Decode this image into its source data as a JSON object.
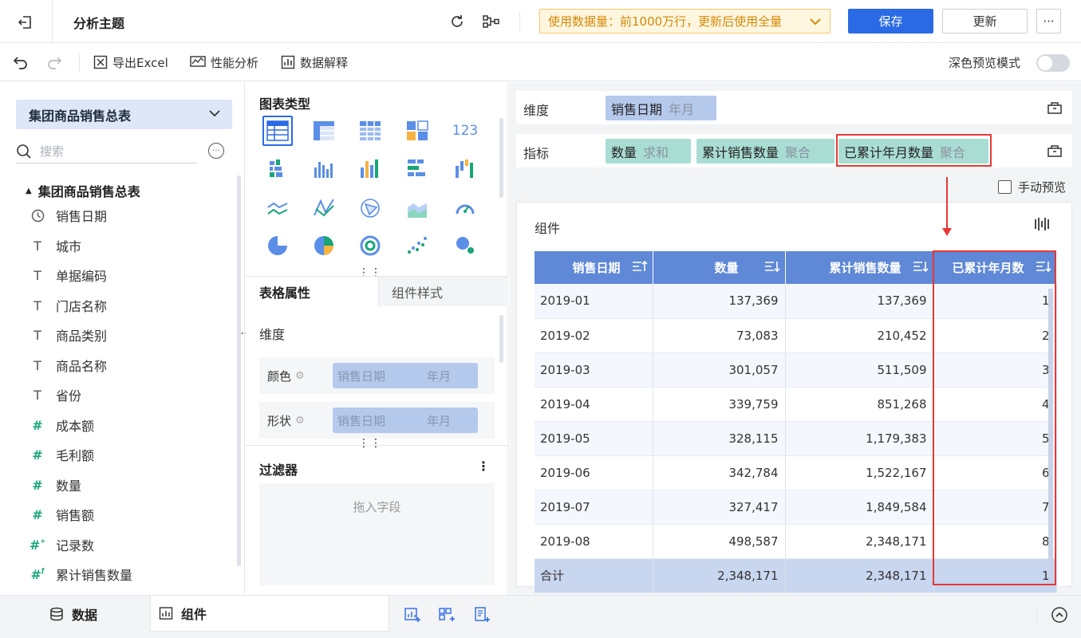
{
  "header": {
    "title": "分析主题",
    "data_usage": "使用数据量：前1000万行，更新后使用全量",
    "save_label": "保存",
    "update_label": "更新",
    "more_label": "···"
  },
  "toolbar": {
    "export_excel": "导出Excel",
    "performance": "性能分析",
    "data_explain": "数据解释",
    "dark_preview": "深色预览模式"
  },
  "left": {
    "dataset": "集团商品销售总表",
    "search_placeholder": "搜索",
    "tree_root": "集团商品销售总表",
    "fields": [
      {
        "icon": "clock-icon",
        "name": "销售日期"
      },
      {
        "icon": "text-icon",
        "name": "城市"
      },
      {
        "icon": "text-icon",
        "name": "单据编码"
      },
      {
        "icon": "text-icon",
        "name": "门店名称"
      },
      {
        "icon": "text-icon",
        "name": "商品类别"
      },
      {
        "icon": "text-icon",
        "name": "商品名称"
      },
      {
        "icon": "text-icon",
        "name": "省份"
      },
      {
        "icon": "number-icon",
        "name": "成本额"
      },
      {
        "icon": "number-icon",
        "name": "毛利额"
      },
      {
        "icon": "number-icon",
        "name": "数量"
      },
      {
        "icon": "number-icon",
        "name": "销售额"
      },
      {
        "icon": "record-count-icon",
        "name": "记录数"
      },
      {
        "icon": "calculated-field-icon",
        "name": "累计销售数量"
      }
    ]
  },
  "middle": {
    "chart_types_title": "图表类型",
    "tab_table_props": "表格属性",
    "tab_component_style": "组件样式",
    "dimension_label": "维度",
    "color_label": "颜色",
    "shape_label": "形状",
    "color_field": "销售日期",
    "color_field_sub": "年月",
    "shape_field": "销售日期",
    "shape_field_sub": "年月",
    "filter_title": "过滤器",
    "filter_placeholder": "拖入字段"
  },
  "right": {
    "dimension_label": "维度",
    "metric_label": "指标",
    "dimension_chip": {
      "name": "销售日期",
      "sub": "年月"
    },
    "metric_chips": [
      {
        "name": "数量",
        "sub": "求和"
      },
      {
        "name": "累计销售数量",
        "sub": "聚合"
      },
      {
        "name": "已累计年月数量",
        "sub": "聚合"
      }
    ],
    "manual_preview": "手动预览",
    "component_title": "组件",
    "table": {
      "headers": [
        "销售日期",
        "数量",
        "累计销售数量",
        "已累计年月数"
      ],
      "rows": [
        [
          "2019-01",
          "137,369",
          "137,369",
          "1"
        ],
        [
          "2019-02",
          "73,083",
          "210,452",
          "2"
        ],
        [
          "2019-03",
          "301,057",
          "511,509",
          "3"
        ],
        [
          "2019-04",
          "339,759",
          "851,268",
          "4"
        ],
        [
          "2019-05",
          "328,115",
          "1,179,383",
          "5"
        ],
        [
          "2019-06",
          "342,784",
          "1,522,167",
          "6"
        ],
        [
          "2019-07",
          "327,417",
          "1,849,584",
          "7"
        ],
        [
          "2019-08",
          "498,587",
          "2,348,171",
          "8"
        ]
      ],
      "total": [
        "合计",
        "2,348,171",
        "2,348,171",
        "1"
      ]
    }
  },
  "bottom": {
    "tab_data": "数据",
    "tab_component": "组件"
  },
  "colors": {
    "primary": "#2b6ae5",
    "header_blue": "#5f88d6",
    "chip_blue": "#b5c9ec",
    "chip_green": "#a9ddd3",
    "highlight_red": "#e53935",
    "warning_orange": "#d48806"
  }
}
